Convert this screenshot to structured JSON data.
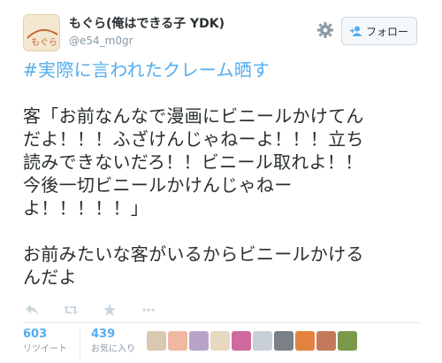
{
  "user": {
    "display_name": "もぐら(俺はできる子 YDK)",
    "handle": "@e54_m0gr",
    "avatar_text": "もぐら"
  },
  "follow_button": {
    "label": "フォロー",
    "icon": "add-user-icon"
  },
  "settings_icon": "gear-icon",
  "tweet": {
    "hashtag": "#実際に言われたクレーム晒す",
    "line1": "客「お前なんなで漫画にビニールかけてん",
    "line2": "だよ！！！ふざけんじゃねーよ！！！立ち",
    "line3": "読みできないだろ！！ビニール取れよ！！",
    "line4": "今後一切ビニールかけんじゃねー",
    "line5": "よ！！！！！」",
    "line6": "お前みたいな客がいるからビニールかける",
    "line7": "んだよ"
  },
  "actions": [
    "reply-icon",
    "retweet-icon",
    "favorite-icon",
    "more-icon"
  ],
  "stats": {
    "retweets_count": "603",
    "retweets_label": "リツイート",
    "favorites_count": "439",
    "favorites_label": "お気に入り"
  },
  "colors": {
    "accent": "#55acee",
    "text": "#292f33",
    "muted": "#8899a6",
    "border": "#e1e8ed"
  }
}
